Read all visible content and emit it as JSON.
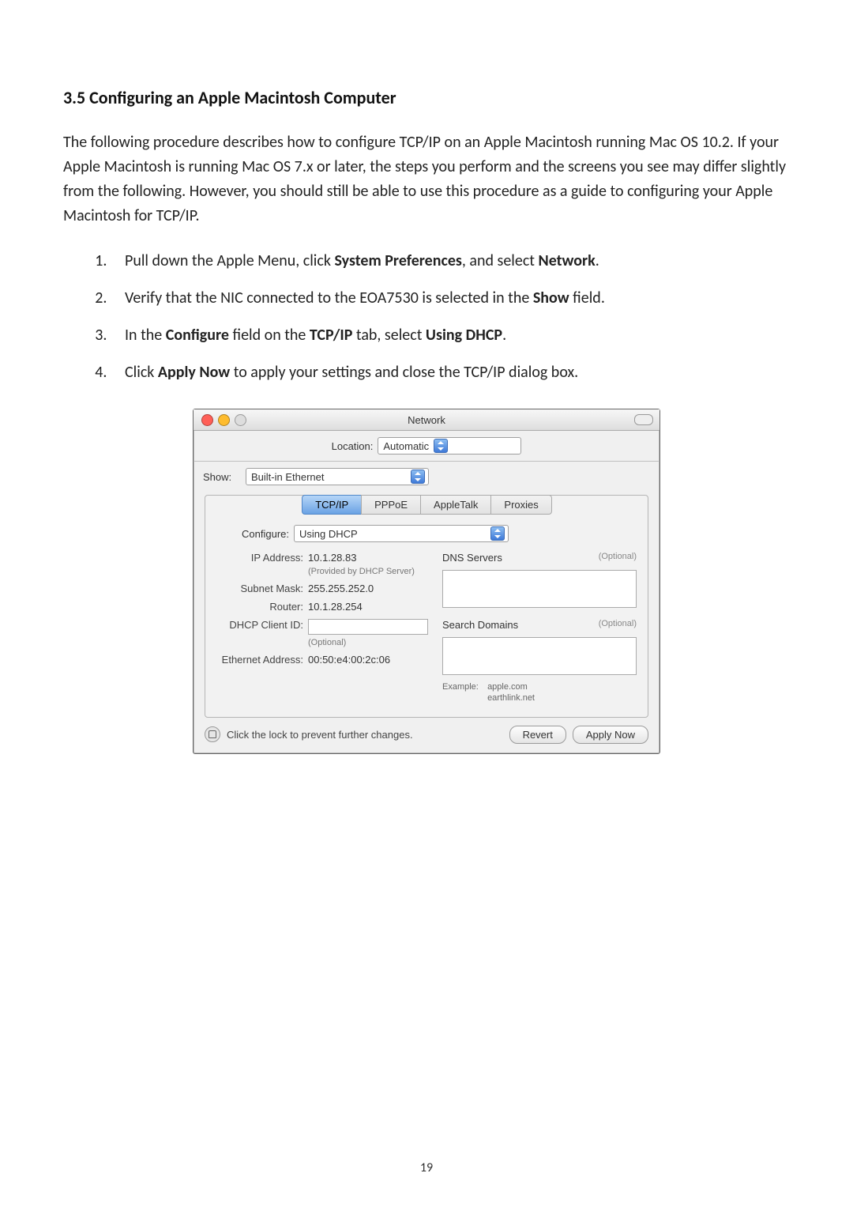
{
  "heading": "3.5 Configuring an Apple Macintosh Computer",
  "intro": "The following procedure describes how to configure TCP/IP on an Apple Macintosh running Mac OS 10.2. If your Apple Macintosh is running Mac OS 7.x or later, the steps you perform and the screens you see may differ slightly from the following. However, you should still be able to use this procedure as a guide to configuring your Apple Macintosh for TCP/IP.",
  "steps": {
    "s1_a": "Pull down the Apple Menu, click ",
    "s1_b": "System Preferences",
    "s1_c": ", and select ",
    "s1_d": "Network",
    "s1_e": ".",
    "s2_a": "Verify that the NIC connected to the EOA7530 is selected in the ",
    "s2_b": "Show",
    "s2_c": " field.",
    "s3_a": "In the ",
    "s3_b": "Configure",
    "s3_c": " field on the ",
    "s3_d": "TCP/IP",
    "s3_e": " tab, select ",
    "s3_f": "Using DHCP",
    "s3_g": ".",
    "s4_a": "Click ",
    "s4_b": "Apply Now",
    "s4_c": " to apply your settings and close the TCP/IP dialog box."
  },
  "window": {
    "title": "Network",
    "location_label": "Location:",
    "location_value": "Automatic",
    "show_label": "Show:",
    "show_value": "Built-in Ethernet",
    "tabs": [
      "TCP/IP",
      "PPPoE",
      "AppleTalk",
      "Proxies"
    ],
    "configure_label": "Configure:",
    "configure_value": "Using DHCP",
    "ip_label": "IP Address:",
    "ip_value": "10.1.28.83",
    "ip_sub": "(Provided by DHCP Server)",
    "subnet_label": "Subnet Mask:",
    "subnet_value": "255.255.252.0",
    "router_label": "Router:",
    "router_value": "10.1.28.254",
    "client_label": "DHCP Client ID:",
    "client_sub": "(Optional)",
    "eth_label": "Ethernet Address:",
    "eth_value": "00:50:e4:00:2c:06",
    "dns_label": "DNS Servers",
    "search_label": "Search Domains",
    "optional": "(Optional)",
    "example_label": "Example:",
    "example1": "apple.com",
    "example2": "earthlink.net",
    "lock_text": "Click the lock to prevent further changes.",
    "revert": "Revert",
    "apply": "Apply Now"
  },
  "page_number": "19"
}
